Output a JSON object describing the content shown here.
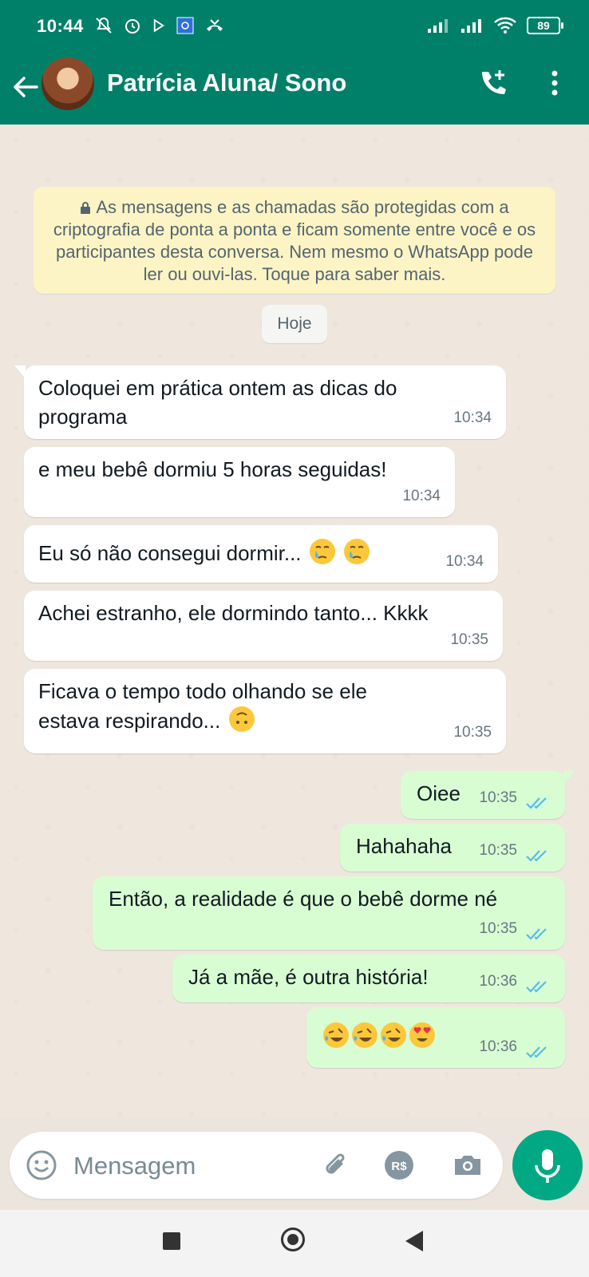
{
  "status_bar": {
    "time": "10:44",
    "battery": "89"
  },
  "header": {
    "contact_name": "Patrícia Aluna/ Sono"
  },
  "chat": {
    "encryption_notice": "As mensagens e as chamadas são protegidas com a criptografia de ponta a ponta e ficam somente entre você e os participantes desta conversa. Nem mesmo o WhatsApp pode ler ou ouvi-las. Toque para saber mais.",
    "date_separator": "Hoje",
    "messages": [
      {
        "direction": "in",
        "text_line1": "Coloquei em prática ontem as dicas do",
        "text_line2": "programa",
        "time": "10:34"
      },
      {
        "direction": "in",
        "text": "e meu bebê dormiu 5 horas seguidas!",
        "time": "10:34"
      },
      {
        "direction": "in",
        "text": "Eu só não consegui dormir...",
        "emojis": [
          "crying-face",
          "crying-face"
        ],
        "time": "10:34"
      },
      {
        "direction": "in",
        "text": "Achei estranho, ele dormindo tanto... Kkkk",
        "time": "10:35"
      },
      {
        "direction": "in",
        "text_line1": "Ficava o tempo todo olhando  se ele",
        "text_line2": "estava respirando...",
        "emojis": [
          "upside-down-face"
        ],
        "time": "10:35"
      },
      {
        "direction": "out",
        "text": "Oiee",
        "time": "10:35",
        "status": "read"
      },
      {
        "direction": "out",
        "text": "Hahahaha",
        "time": "10:35",
        "status": "read"
      },
      {
        "direction": "out",
        "text": "Então, a realidade é que o bebê dorme né",
        "time": "10:35",
        "status": "read"
      },
      {
        "direction": "out",
        "text": "Já a mãe, é outra história!",
        "time": "10:36",
        "status": "read"
      },
      {
        "direction": "out",
        "emojis": [
          "rolling-laughing-face",
          "rolling-laughing-face",
          "rolling-laughing-face",
          "heart-eyes-face"
        ],
        "time": "10:36",
        "status": "read"
      }
    ]
  },
  "composer": {
    "placeholder": "Mensagem"
  },
  "colors": {
    "header": "#008069",
    "accent": "#00a884",
    "outgoing_bubble": "#d9fdd3",
    "incoming_bubble": "#ffffff",
    "read_ticks": "#53bdeb",
    "encryption_notice_bg": "#fdf4c5"
  }
}
